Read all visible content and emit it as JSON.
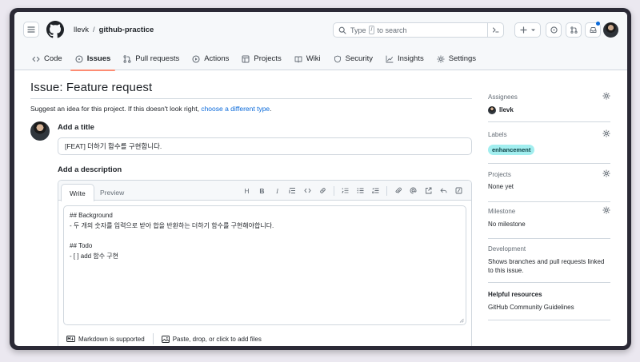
{
  "header": {
    "owner": "llevk",
    "separator": "/",
    "repo": "github-practice",
    "search": {
      "prefix": "Type",
      "key": "/",
      "suffix": "to search"
    }
  },
  "nav": {
    "tabs": [
      {
        "label": "Code",
        "icon": "code-icon"
      },
      {
        "label": "Issues",
        "icon": "issue-icon",
        "active": true
      },
      {
        "label": "Pull requests",
        "icon": "pull-request-icon"
      },
      {
        "label": "Actions",
        "icon": "play-icon"
      },
      {
        "label": "Projects",
        "icon": "table-icon"
      },
      {
        "label": "Wiki",
        "icon": "book-icon"
      },
      {
        "label": "Security",
        "icon": "shield-icon"
      },
      {
        "label": "Insights",
        "icon": "graph-icon"
      },
      {
        "label": "Settings",
        "icon": "gear-icon"
      }
    ]
  },
  "main": {
    "page_title": "Issue: Feature request",
    "suggest_text": "Suggest an idea for this project. If this doesn't look right,",
    "suggest_link": "choose a different type",
    "suggest_end": ".",
    "title_label": "Add a title",
    "title_value": "[FEAT] 더하기 함수를 구현합니다.",
    "description_label": "Add a description",
    "editor": {
      "write_tab": "Write",
      "preview_tab": "Preview",
      "toolbar": {
        "heading": "H",
        "bold": "B",
        "italic": "I"
      },
      "lines": [
        "## Background",
        "- 두 개의 숫자를 입력으로 받아 합을 반환하는 더하기 함수를 구현해야합니다.",
        "",
        "## Todo",
        "- [ ] add 함수 구현"
      ],
      "markdown_note": "Markdown is supported",
      "attach_note": "Paste, drop, or click to add files"
    }
  },
  "sidebar": {
    "assignees": {
      "heading": "Assignees",
      "value": "llevk"
    },
    "labels": {
      "heading": "Labels",
      "value": "enhancement",
      "color": "#a2eeef"
    },
    "projects": {
      "heading": "Projects",
      "value": "None yet"
    },
    "milestone": {
      "heading": "Milestone",
      "value": "No milestone"
    },
    "development": {
      "heading": "Development",
      "value": "Shows branches and pull requests linked to this issue."
    },
    "helpful": {
      "heading": "Helpful resources",
      "link": "GitHub Community Guidelines"
    }
  },
  "colors": {
    "accent": "#fd8c73",
    "link": "#0969da",
    "border": "#d0d7de"
  }
}
